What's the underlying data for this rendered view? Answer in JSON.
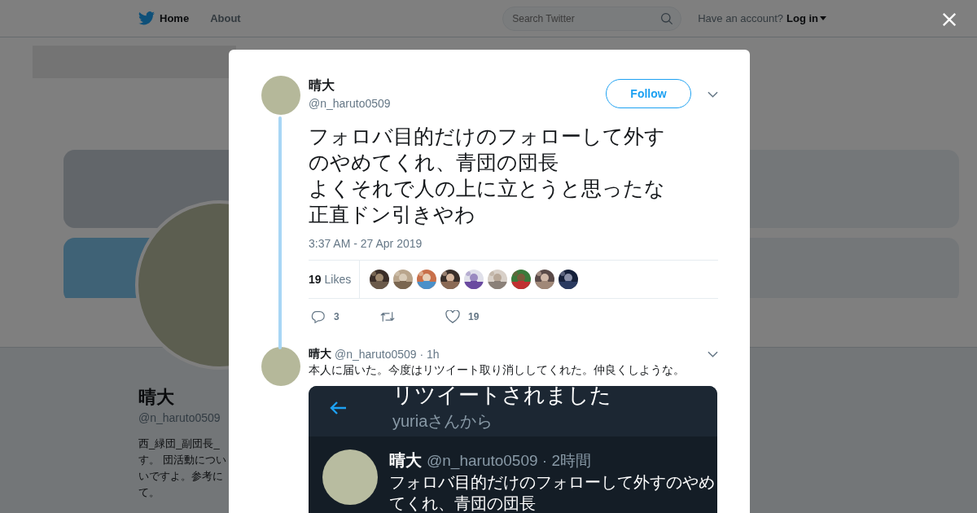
{
  "nav": {
    "links": [
      {
        "label": "Home",
        "selected": true
      },
      {
        "label": "About",
        "selected": false
      }
    ],
    "search": {
      "placeholder": "Search Twitter"
    },
    "account_prompt": "Have an account?",
    "login": "Log in"
  },
  "header": {
    "kind": "picture"
  },
  "profile": {
    "name": "晴大",
    "handle": "@n_haruto0509",
    "bio_lines": [
      "西_緑団_副団長_",
      "す。 団活動につい",
      "いですよ。参考に",
      "て。"
    ]
  },
  "tweet": {
    "name": "晴大",
    "handle": "@n_haruto0509",
    "follow_label": "Follow",
    "text_lines": [
      "フォロバ目的だけのフォローして外すのやめてくれ、青団の団長",
      "よくそれで人の上に立とうと思ったな",
      "正直ドン引きやわ"
    ],
    "timestamp": "3:37 AM - 27 Apr 2019",
    "likes_count": "19",
    "likes_label": "Likes",
    "likers": [
      {
        "kind": "picture"
      },
      {
        "kind": "picture"
      },
      {
        "kind": "picture"
      },
      {
        "kind": "picture"
      },
      {
        "kind": "picture"
      },
      {
        "kind": "picture"
      },
      {
        "kind": "picture"
      },
      {
        "kind": "picture"
      },
      {
        "kind": "picture"
      }
    ],
    "actions": [
      {
        "kind": "reply",
        "count": "3"
      },
      {
        "kind": "retweet"
      },
      {
        "kind": "like",
        "count": "19"
      }
    ]
  },
  "reply": {
    "name": "晴大",
    "meta": "@n_haruto0509 · 1h",
    "text": "本人に届いた。今度はリツイート取り消ししてくれた。仲良くしような。",
    "screenshot": {
      "title": "リツイートされました",
      "subtitle": "yuriaさんから",
      "name": "晴大",
      "meta": "@n_haruto0509 · 2時間",
      "lines": [
        "フォロバ目的だけのフォローして外すのやめ",
        "てくれ、青団の団長"
      ]
    }
  }
}
